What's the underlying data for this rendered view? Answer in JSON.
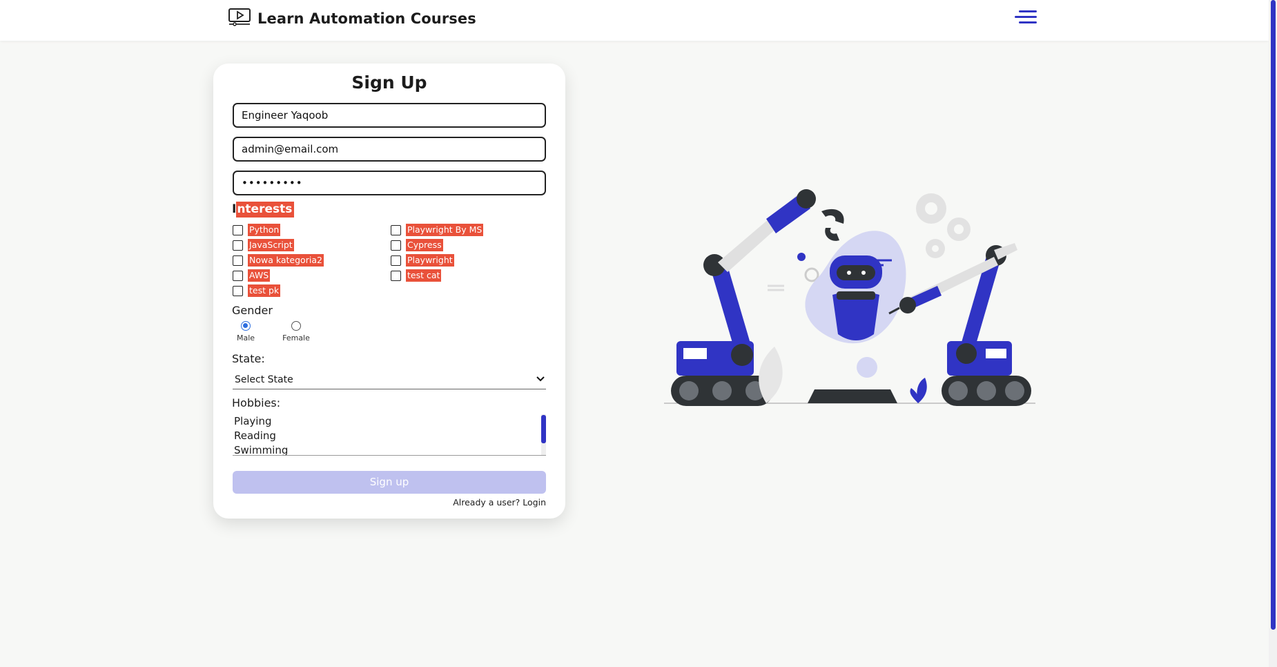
{
  "header": {
    "title": "Learn Automation Courses",
    "logo_icon": "video-player-icon",
    "menu_icon": "hamburger-menu-icon"
  },
  "form": {
    "title": "Sign Up",
    "name_value": "Engineer Yaqoob",
    "email_value": "admin@email.com",
    "password_value": "•••••••••",
    "interests_first_letter": "I",
    "interests_rest": "nterests",
    "interests": [
      {
        "label": "Python",
        "checked": false
      },
      {
        "label": "JavaScript",
        "checked": false
      },
      {
        "label": "Nowa kategoria2",
        "checked": false
      },
      {
        "label": "AWS",
        "checked": false
      },
      {
        "label": "test pk",
        "checked": false
      },
      {
        "label": "Playwright By MS",
        "checked": false
      },
      {
        "label": "Cypress",
        "checked": false
      },
      {
        "label": "Playwright",
        "checked": false
      },
      {
        "label": "test cat",
        "checked": false
      }
    ],
    "gender_label": "Gender",
    "gender_options": [
      {
        "label": "Male",
        "checked": true
      },
      {
        "label": "Female",
        "checked": false
      }
    ],
    "state_label": "State:",
    "state_selected": "Select State",
    "hobbies_label": "Hobbies:",
    "hobbies": [
      "Playing",
      "Reading",
      "Swimming"
    ],
    "submit_label": "Sign up",
    "login_prompt": "Already a user? ",
    "login_link": "Login"
  },
  "colors": {
    "accent": "#3034c4",
    "highlight": "#e9513a",
    "button_disabled": "#bfc1ef"
  },
  "illustration": {
    "icon": "robot-arms-illustration"
  }
}
